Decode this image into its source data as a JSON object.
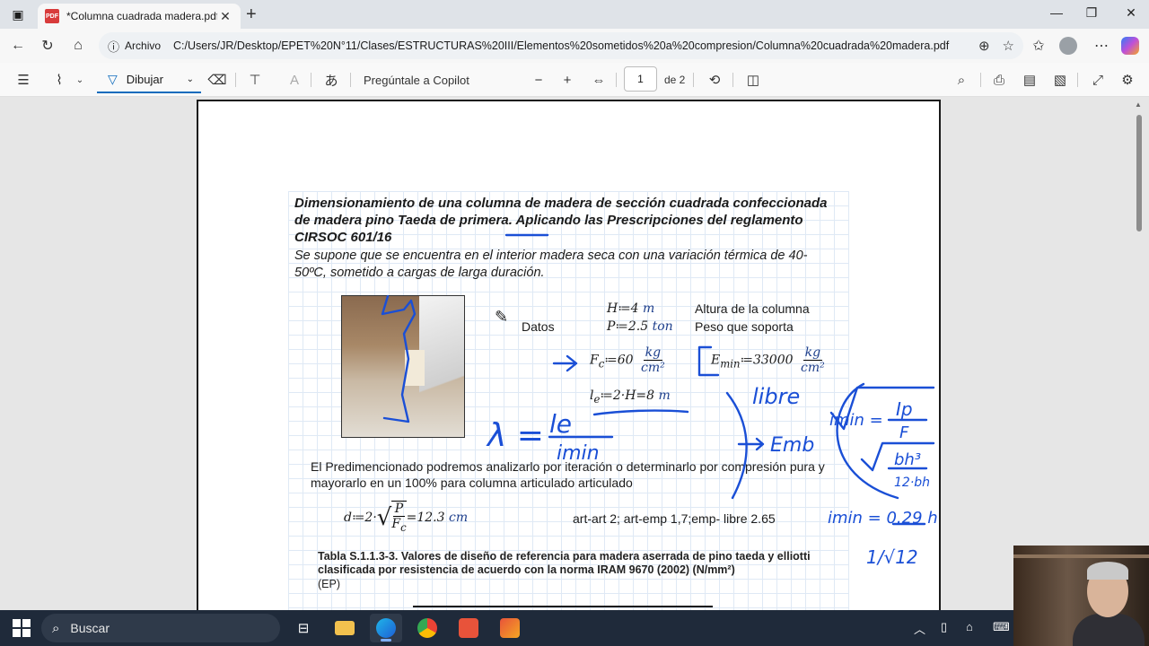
{
  "browser": {
    "tab_title": "*Columna cuadrada madera.pdf",
    "tab_icon": "pdf-icon",
    "address_label": "Archivo",
    "url": "C:/Users/JR/Desktop/EPET%20N°11/Clases/ESTRUCTURAS%20III/Elementos%20sometidos%20a%20compresion/Columna%20cuadrada%20madera.pdf"
  },
  "pdf_toolbar": {
    "draw_label": "Dibujar",
    "copilot_label": "Pregúntale a Copilot",
    "page_current": "1",
    "page_total": "de 2",
    "accent_color": "#0f6cbd"
  },
  "document": {
    "heading": "Dimensionamiento de una columna de madera de sección cuadrada confeccionada de madera pino Taeda de primera. Aplicando las Prescripciones del reglamento CIRSOC 601/16",
    "intro": "Se supone que se encuentra en el interior madera seca con una variación térmica de 40-50ºC, sometido a cargas de larga duración.",
    "datos_label": "Datos",
    "h_eq": "H≔4 ",
    "h_unit": "m",
    "h_desc": "Altura de la columna",
    "p_eq": "P≔2.5 ",
    "p_unit": "ton",
    "p_desc": "Peso que soporta",
    "fc_lhs": "F",
    "fc_sub": "c",
    "fc_eq": "≔60",
    "fc_num": "kg",
    "fc_den": "cm²",
    "emin_lhs": "E",
    "emin_sub": "min",
    "emin_eq": "≔33000",
    "emin_num": "kg",
    "emin_den": "cm²",
    "le_lhs": "l",
    "le_sub": "e",
    "le_eq": "≔2·H=8 ",
    "le_unit": "m",
    "para": "El Predimencionado podremos analizarlo por iteración o determinarlo por compresión pura y mayorarlo en un 100% para columna articulado articulado",
    "d_eq": "d≔2·",
    "d_num": "P",
    "d_den": "F",
    "d_den_sub": "c",
    "d_result": "=12.3 ",
    "d_unit": "cm",
    "art_note": "art-art 2; art-emp 1,7;emp- libre 2.65",
    "table_title": "Tabla S.1.1.3-3. Valores de diseño de referencia para madera aserrada de pino taeda y elliotti clasificada por resistencia de acuerdo con la norma IRAM 9670 (2002) (N/mm²)",
    "table_sub": "(EP)"
  },
  "ink": {
    "color": "#1a4fd6",
    "lambda_lhs": "λ =",
    "lambda_num": "le",
    "lambda_den": "imin",
    "libre": "libre",
    "emb": "Emb",
    "imin_eq": "imin =",
    "ip": "Ip",
    "f": "F",
    "bh": "bh³",
    "twelve": "12·bh",
    "imin_result": "imin = 0.29 h",
    "sqrt12": "1/√12"
  },
  "taskbar": {
    "search_label": "Buscar"
  }
}
